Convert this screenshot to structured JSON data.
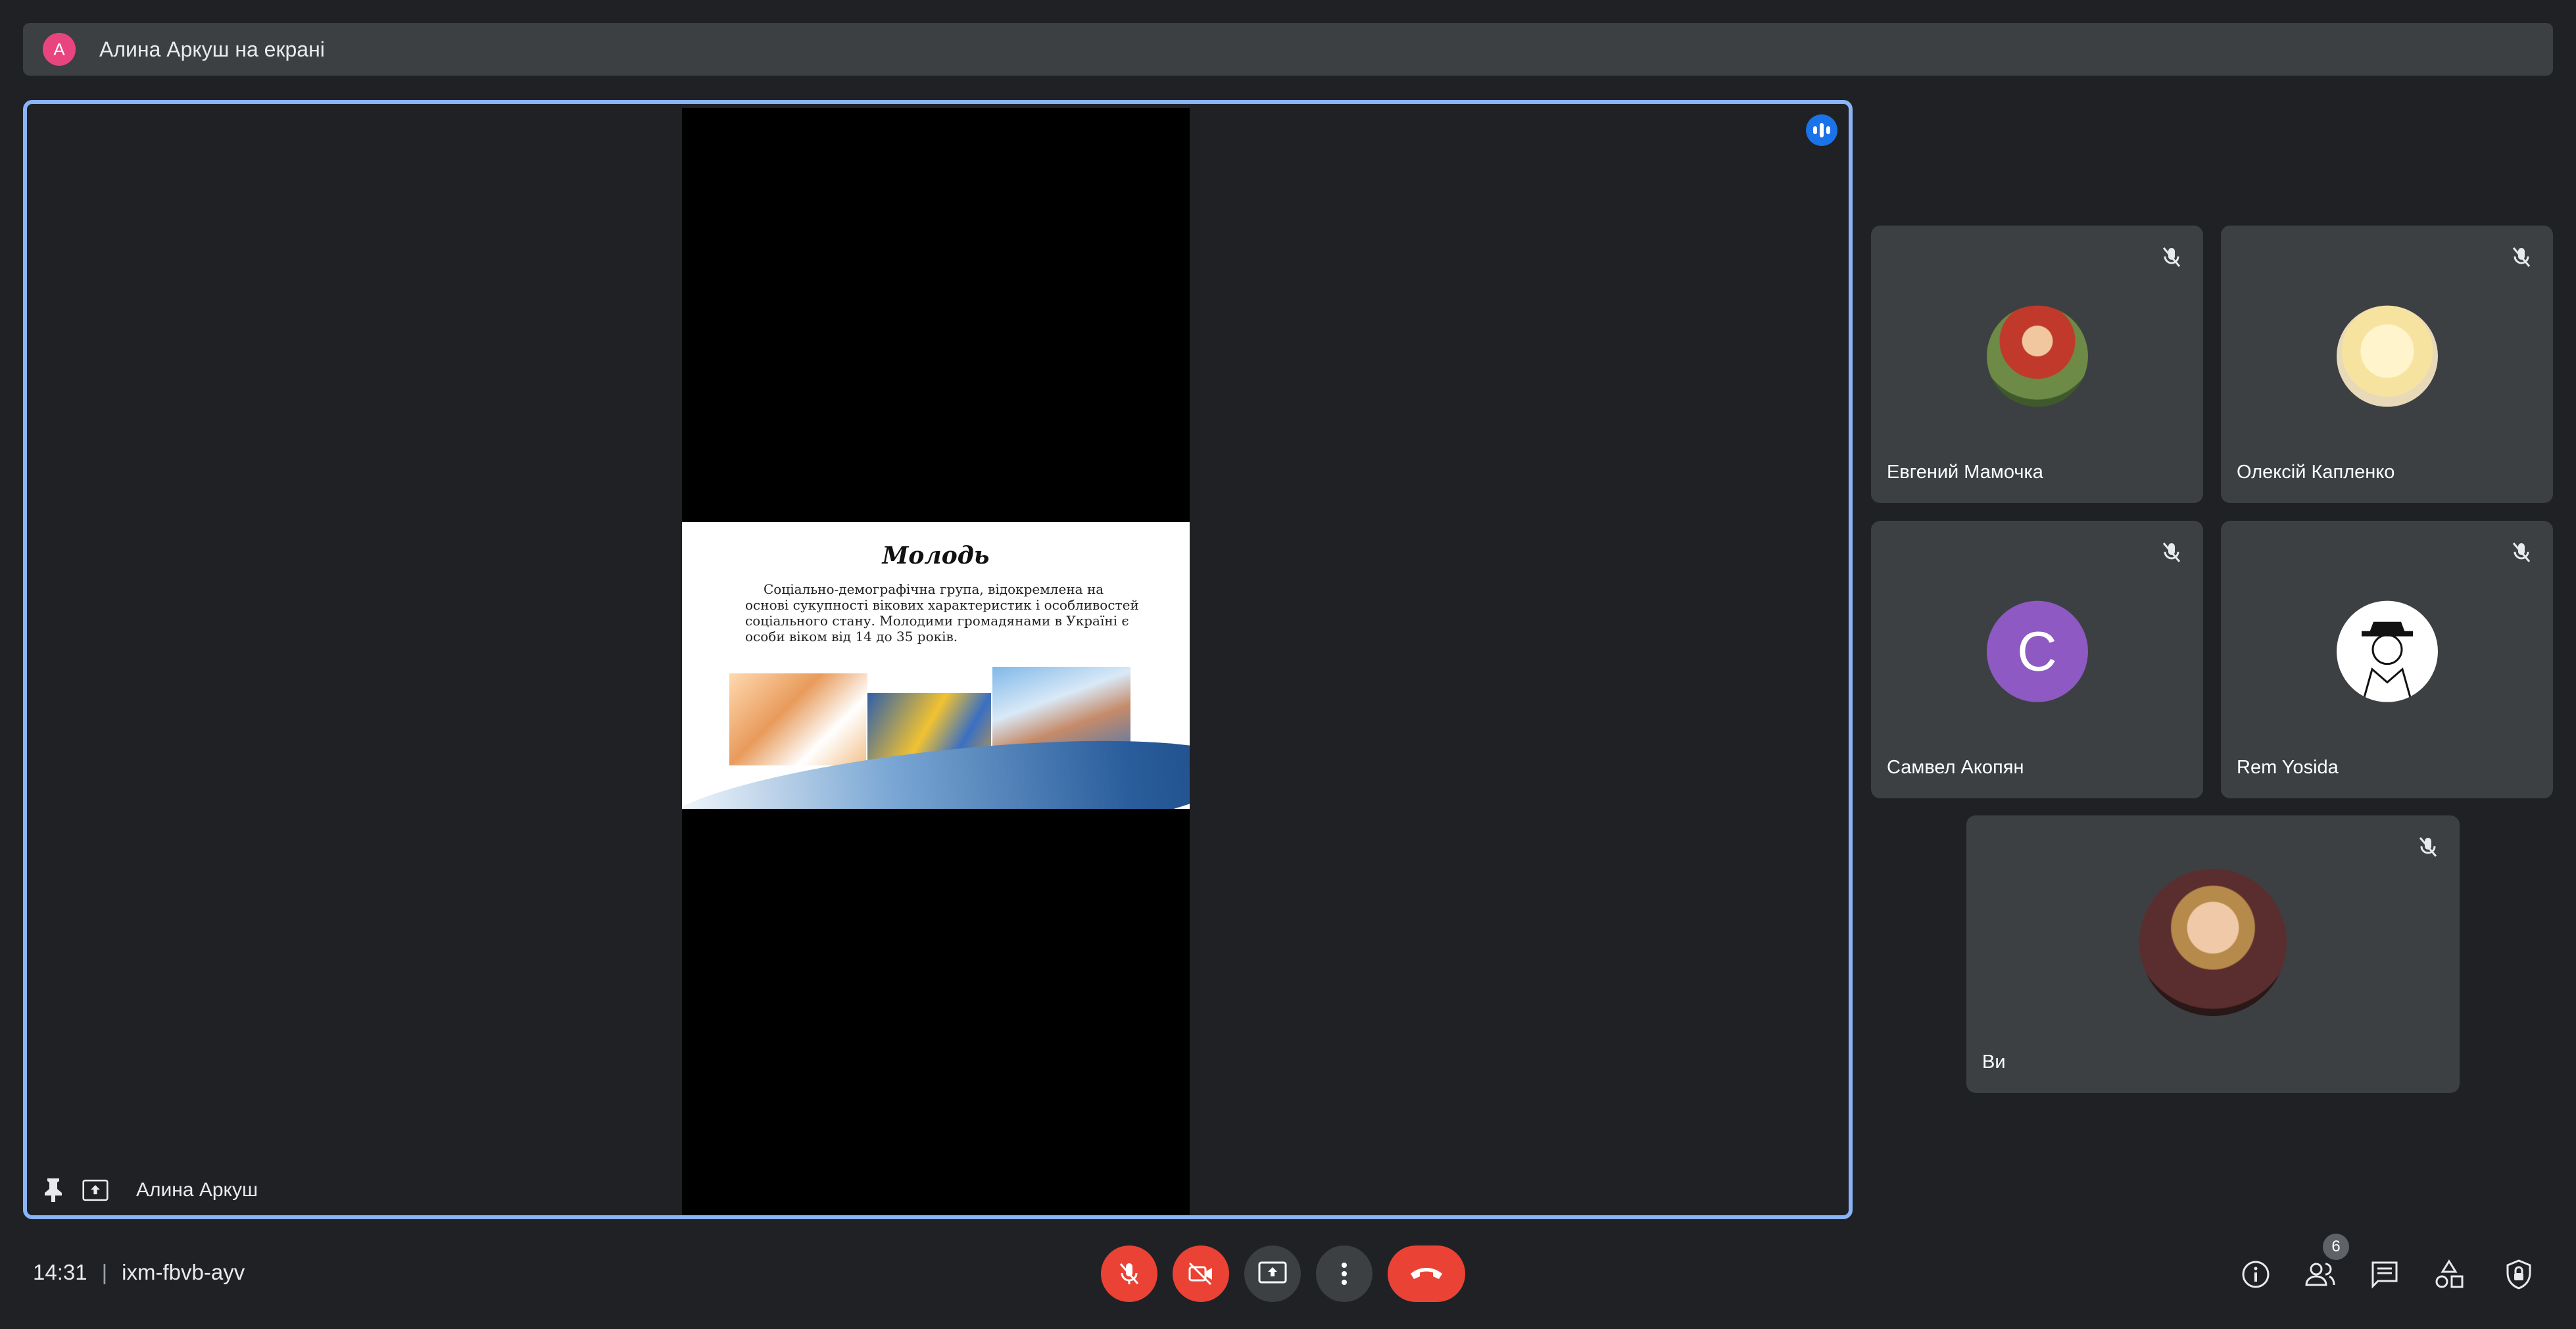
{
  "banner": {
    "avatar_letter": "A",
    "text": "Алина Аркуш на екрані"
  },
  "stage": {
    "presenter_name": "Алина Аркуш",
    "slide": {
      "title": "Молодь",
      "body": "Соціально-демографічна група, відокремлена на основі сукупності вікових характеристик і особливостей соціального стану. Молодими громадянами в Україні є особи віком від 14 до 35 років."
    }
  },
  "participants": [
    {
      "name": "Евгений Мамочка",
      "muted": true,
      "avatar": "photo"
    },
    {
      "name": "Олексій Капленко",
      "muted": true,
      "avatar": "photo"
    },
    {
      "name": "Самвел Акопян",
      "muted": true,
      "avatar_letter": "C"
    },
    {
      "name": "Rem Yosida",
      "muted": true,
      "avatar": "drawing"
    },
    {
      "name": "Ви",
      "muted": true,
      "avatar": "photo"
    }
  ],
  "bottom": {
    "time": "14:31",
    "meeting_code": "ixm-fbvb-ayv",
    "people_count": "6"
  },
  "colors": {
    "end_call": "#ea4335",
    "active_border": "#8ab4f8",
    "tile": "#3c4043",
    "bg": "#202124"
  },
  "icons": [
    "pin-icon",
    "present-icon",
    "mic-off-icon",
    "camera-off-icon",
    "present-screen-icon",
    "more-vert-icon",
    "call-end-icon",
    "info-icon",
    "people-icon",
    "chat-icon",
    "activities-icon",
    "host-controls-icon",
    "talking-indicator-icon"
  ]
}
